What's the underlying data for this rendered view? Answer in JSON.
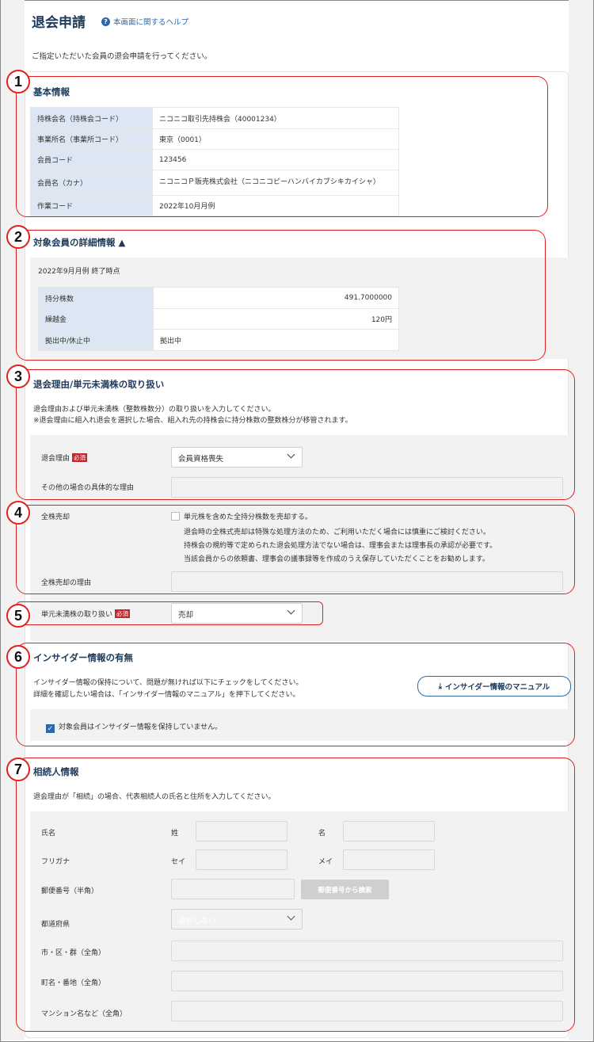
{
  "header": {
    "title": "退会申請",
    "help_link": "本画面に関するヘルプ",
    "intro": "ご指定いただいた会員の退会申請を行ってください。"
  },
  "badges": [
    "1",
    "2",
    "3",
    "4",
    "5",
    "6",
    "7"
  ],
  "basic_info": {
    "title": "基本情報",
    "rows": [
      {
        "label": "持株会名（持株会コード）",
        "value": "ニコニコ取引先持株会（40001234）"
      },
      {
        "label": "事業所名（事業所コード）",
        "value": "東京（0001）"
      },
      {
        "label": "会員コード",
        "value": "123456"
      },
      {
        "label": "会員名（カナ）",
        "value": "ニコニコＰ販売株式会社（ニコニコピーハンバイカブシキカイシャ）"
      },
      {
        "label": "作業コード",
        "value": "2022年10月月例"
      }
    ]
  },
  "details": {
    "title": "対象会員の詳細情報 ▲",
    "as_of": "2022年9月月例 終了時点",
    "rows": [
      {
        "label": "持分株数",
        "value": "491.7000000"
      },
      {
        "label": "繰越金",
        "value": "120円"
      },
      {
        "label": "拠出中/休止中",
        "value": "拠出中"
      }
    ]
  },
  "reason": {
    "title": "退会理由/単元未満株の取り扱い",
    "note1": "退会理由および単元未満株（整数株数分）の取り扱いを入力してください。",
    "note2": "※退会理由に組入れ退会を選択した場合、組入れ先の持株会に持分株数の整数株分が移管されます。",
    "reason_label": "退会理由",
    "required": "必須",
    "reason_value": "会員資格喪失",
    "other_label": "その他の場合の具体的な理由"
  },
  "sale": {
    "label": "全株売却",
    "checkbox_label": "単元株を含めた全持分株数を売却する。",
    "note1": "退会時の全株式売却は特殊な処理方法のため、ご利用いただく場合には慎重にご検討ください。",
    "note2": "持株会の規約等で定められた退会処理方法でない場合は、理事会または理事長の承認が必要です。",
    "note3": "当該会員からの依頼書、理事会の議事録等を作成のうえ保存していただくことをお勧めします。",
    "reason_label": "全株売却の理由"
  },
  "odd_lot": {
    "label": "単元未満株の取り扱い",
    "required": "必須",
    "value": "売却"
  },
  "insider": {
    "title": "インサイダー情報の有無",
    "note1": "インサイダー情報の保持について、問題が無ければ以下にチェックをしてください。",
    "note2": "詳細を確認したい場合は、「インサイダー情報のマニュアル」を押下してください。",
    "manual_button": "インサイダー情報のマニュアル",
    "checkbox_label": "対象会員はインサイダー情報を保持していません。"
  },
  "heir": {
    "title": "相続人情報",
    "note": "退会理由が「相続」の場合、代表相続人の氏名と住所を入力してください。",
    "name_label": "氏名",
    "last_name": "姓",
    "first_name": "名",
    "kana_label": "フリガナ",
    "last_kana": "セイ",
    "first_kana": "メイ",
    "postal_label": "郵便番号（半角）",
    "postal_button": "郵便番号から検索",
    "pref_label": "都道府県",
    "pref_placeholder": "選択しない",
    "city_label": "市・区・群（全角）",
    "town_label": "町名・番地（全角）",
    "building_label": "マンション名など（全角）"
  }
}
